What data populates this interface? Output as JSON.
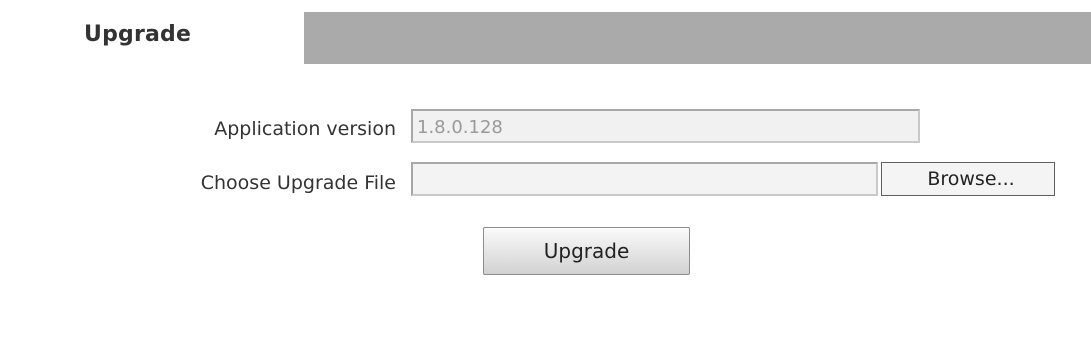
{
  "section": {
    "title": "Upgrade"
  },
  "form": {
    "app_version_label": "Application version",
    "app_version_value": "1.8.0.128",
    "upgrade_file_label": "Choose Upgrade File",
    "upgrade_file_value": "",
    "browse_label": "Browse...",
    "submit_label": "Upgrade"
  },
  "colors": {
    "title_bar": "#aaaaaa",
    "title_text": "#333333",
    "disabled_text": "#9a9a9a"
  }
}
